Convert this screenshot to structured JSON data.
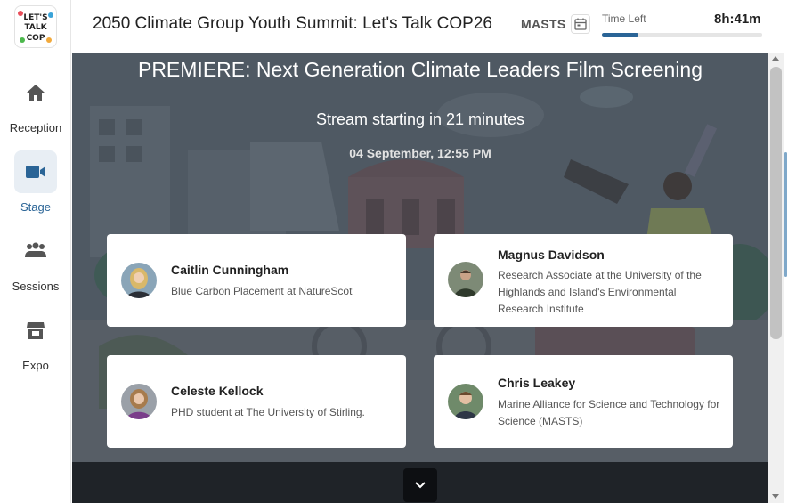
{
  "app": {
    "title": "2050 Climate Group Youth Summit: Let's Talk COP26",
    "org": "MASTS",
    "time_left_label": "Time Left",
    "time_left_value": "8h:41m",
    "time_left_progress": 0.23,
    "logo_text": [
      "LET'S",
      "TALK",
      "COP"
    ]
  },
  "sidebar": {
    "items": [
      {
        "label": "Reception",
        "icon": "home-icon",
        "active": false
      },
      {
        "label": "Stage",
        "icon": "video-camera-icon",
        "active": true
      },
      {
        "label": "Sessions",
        "icon": "people-group-icon",
        "active": false
      },
      {
        "label": "Expo",
        "icon": "store-icon",
        "active": false
      }
    ]
  },
  "stage": {
    "title": "PREMIERE: Next Generation Climate Leaders Film Screening",
    "countdown": "Stream starting in 21 minutes",
    "datetime": "04 September, 12:55 PM",
    "speakers": [
      {
        "name": "Caitlin Cunningham",
        "role": "Blue Carbon Placement at NatureScot"
      },
      {
        "name": "Magnus Davidson",
        "role": "Research Associate at the University of the Highlands and Island's Environmental Research Institute"
      },
      {
        "name": "Celeste Kellock",
        "role": "PHD student at The University of Stirling."
      },
      {
        "name": "Chris Leakey",
        "role": "Marine Alliance for Science and Technology for Science (MASTS)"
      }
    ]
  },
  "colors": {
    "accent": "#2a6496",
    "stage_overlay": "#5d6670",
    "bottom_bar": "#1f2328"
  }
}
